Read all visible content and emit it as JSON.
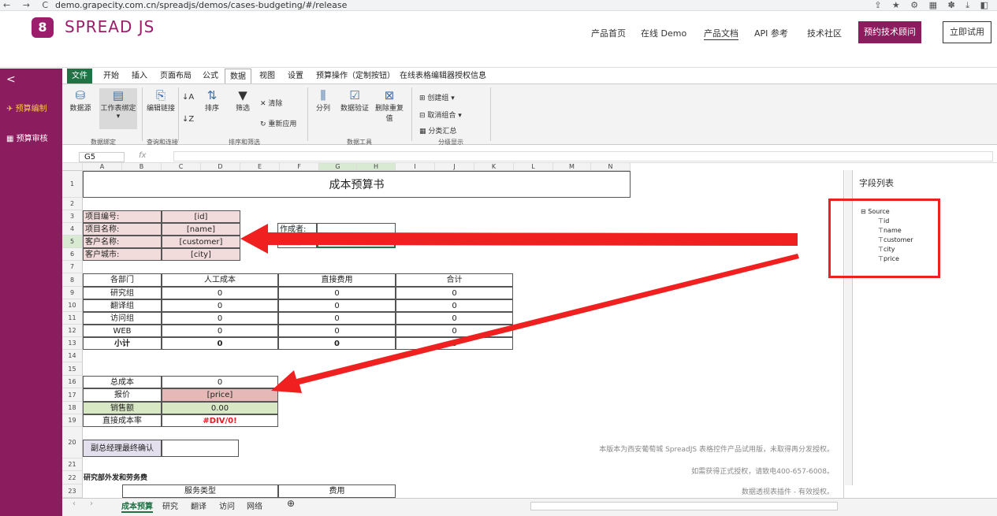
{
  "browser": {
    "nav": "← → C",
    "url": "demo.grapecity.com.cn/spreadjs/demos/cases-budgeting/#/release",
    "ext_icons": "⇪ ★ ⚙ ▦ ✽ ⤓ ◧"
  },
  "header": {
    "logo_mark": "8",
    "logo_text": "SPREAD JS",
    "nav": [
      "产品首页",
      "在线 Demo",
      "产品文档",
      "API 参考",
      "技术社区"
    ],
    "consult": "预约技术顾问",
    "try": "立即试用"
  },
  "sidebar": {
    "collapse": "<",
    "items": [
      {
        "icon": "✈",
        "label": "预算编制"
      },
      {
        "icon": "▦",
        "label": "预算审核"
      }
    ]
  },
  "ribbon": {
    "tabs": [
      "文件",
      "开始",
      "插入",
      "页面布局",
      "公式",
      "数据",
      "视图",
      "设置",
      "预算操作（定制按钮）",
      "在线表格编辑器授权信息"
    ],
    "buttons": {
      "datasource": "数据源",
      "tablebind": "工作表绑定",
      "editlink": "编辑链接",
      "sort": "排序",
      "filter": "筛选",
      "clear": "清除",
      "reapply": "重新应用",
      "split": "分列",
      "validation": "数据验证",
      "dedupe": "删除重复值",
      "group": "创建组",
      "ungroup": "取消组合",
      "subtotal": "分类汇总"
    },
    "groups": [
      "数据绑定",
      "查询和连接",
      "排序和筛选",
      "数据工具",
      "分级显示"
    ]
  },
  "formula": {
    "cell": "G5",
    "fx": "fx"
  },
  "columns": [
    "A",
    "B",
    "C",
    "D",
    "E",
    "F",
    "G",
    "H",
    "I",
    "J",
    "K",
    "L",
    "M",
    "N"
  ],
  "rows": [
    "1",
    "2",
    "3",
    "4",
    "5",
    "6",
    "7",
    "8",
    "9",
    "10",
    "11",
    "12",
    "13",
    "14",
    "15",
    "16",
    "17",
    "18",
    "19",
    "20",
    "21",
    "22",
    "23"
  ],
  "sheet": {
    "title": "成本预算书",
    "proj_labels": [
      "项目编号:",
      "项目名称:",
      "客户名称:",
      "客户城市:"
    ],
    "proj_values": [
      "[id]",
      "[name]",
      "[customer]",
      "[city]"
    ],
    "author_label": "作成者:",
    "date_label": "作成日:",
    "table_headers": [
      "各部门",
      "人工成本",
      "直接费用",
      "合计"
    ],
    "departments": [
      "研究组",
      "翻译组",
      "访问组",
      "WEB"
    ],
    "dept_values": [
      [
        "0",
        "0",
        "0"
      ],
      [
        "0",
        "0",
        "0"
      ],
      [
        "0",
        "0",
        "0"
      ],
      [
        "0",
        "0",
        "0"
      ]
    ],
    "subtotal_label": "小计",
    "subtotal_values": [
      "0",
      "0",
      "0"
    ],
    "total_cost_label": "总成本",
    "total_cost_value": "0",
    "quote_label": "报价",
    "quote_value": "[price]",
    "sales_label": "销售额",
    "sales_value": "0.00",
    "ratio_label": "直接成本率",
    "ratio_value": "#DIV/0!",
    "confirm_label": "副总经理最终确认",
    "section_title": "研究部外发和劳务费",
    "service_header": "服务类型",
    "fee_header": "费用"
  },
  "watermark": [
    "本版本为西安葡萄城 SpreadJS 表格控件产品试用版，未取得再分发授权。",
    "如需获得正式授权，请致电400-657-6008。",
    "数据透视表插件 - 有效授权。"
  ],
  "field_panel": {
    "title": "字段列表",
    "root": "Source",
    "fields": [
      "id",
      "name",
      "customer",
      "city",
      "price"
    ]
  },
  "sheet_tabs": [
    "成本预算",
    "研究",
    "翻译",
    "访问",
    "网络"
  ],
  "add_sheet": "⊕",
  "accent": {
    "brand": "#8b1c5e",
    "excel": "#217346",
    "arrow": "#f02020"
  }
}
